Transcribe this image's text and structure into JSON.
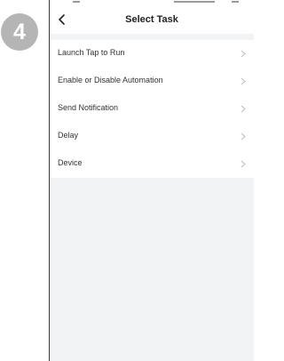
{
  "step_badge": {
    "number": "4",
    "color": "#b5b5b5",
    "icon": "step-number-badge"
  },
  "nav": {
    "title": "Select Task",
    "back_icon": "chevron-left-icon"
  },
  "tasks": [
    {
      "label": "Launch Tap to Run",
      "icon": "chevron-right-icon"
    },
    {
      "label": "Enable or Disable Automation",
      "icon": "chevron-right-icon"
    },
    {
      "label": "Send Notification",
      "icon": "chevron-right-icon"
    },
    {
      "label": "Delay",
      "icon": "chevron-right-icon"
    },
    {
      "label": "Device",
      "icon": "chevron-right-icon"
    }
  ],
  "colors": {
    "background": "#f2f3f5",
    "card": "#ffffff",
    "text": "#333333",
    "chevron": "#bbbbbb",
    "badge": "#b5b5b5"
  }
}
